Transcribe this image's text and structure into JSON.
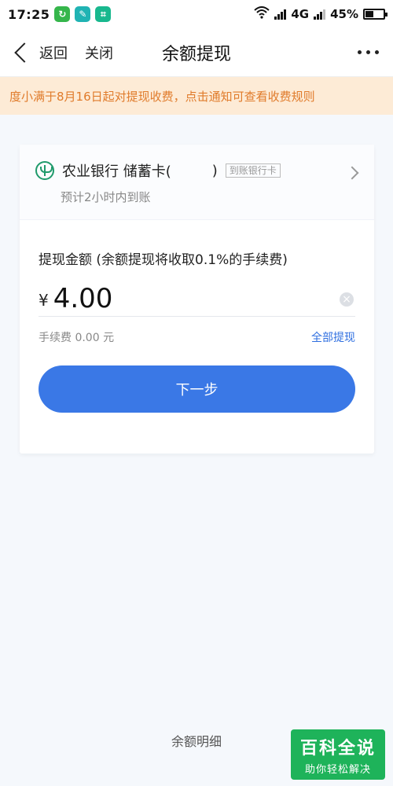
{
  "status_bar": {
    "time": "17:25",
    "network": "4G",
    "battery": "45%",
    "battery_level": 0.45,
    "icons": [
      "wechat-like-app-icon",
      "feather-app-icon",
      "scan-app-icon",
      "wifi-icon",
      "signal-icon",
      "battery-icon"
    ]
  },
  "nav": {
    "back_label": "返回",
    "close_label": "关闭",
    "title": "余额提现"
  },
  "notice": {
    "text": "度小满于8月16日起对提现收费，点击通知可查看收费规则"
  },
  "bank": {
    "name": "农业银行 储蓄卡(",
    "close_paren": ")",
    "tag": "到账银行卡",
    "arrival": "预计2小时内到账",
    "logo_color": "#1f9a6b"
  },
  "amount": {
    "label": "提现金额 (余额提现将收取0.1%的手续费)",
    "currency": "¥",
    "value": "4.00",
    "fee": "手续费 0.00 元",
    "withdraw_all": "全部提现"
  },
  "actions": {
    "next": "下一步",
    "balance_detail": "余额明细"
  },
  "watermark": {
    "title": "百科全说",
    "subtitle": "助你轻松解决"
  },
  "colors": {
    "primary": "#3a78e6",
    "notice_bg": "#fdebd6",
    "notice_text": "#e07b2b",
    "watermark": "#1eb35a"
  }
}
